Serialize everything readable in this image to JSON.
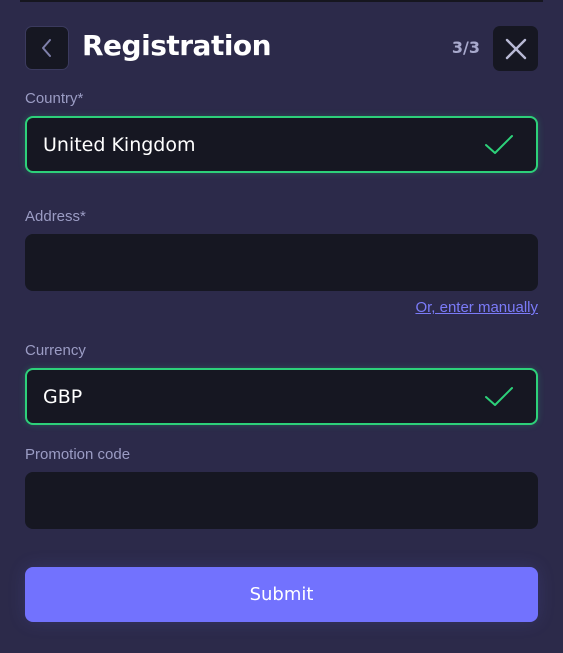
{
  "header": {
    "title": "Registration",
    "step": "3/3",
    "back_icon": "chevron-left-icon",
    "close_icon": "close-icon"
  },
  "form": {
    "country": {
      "label": "Country*",
      "value": "United Kingdom",
      "status": "valid"
    },
    "address": {
      "label": "Address*",
      "value": "",
      "manual_link": "Or, enter manually"
    },
    "currency": {
      "label": "Currency",
      "value": "GBP",
      "status": "valid"
    },
    "promotion_code": {
      "label": "Promotion code",
      "value": ""
    },
    "submit_label": "Submit"
  },
  "colors": {
    "background": "#2c2a4a",
    "field_background": "#161722",
    "valid_border": "#2dd17a",
    "accent": "#7272fe",
    "link": "#7b7bf8",
    "label": "#9b9cc4"
  }
}
